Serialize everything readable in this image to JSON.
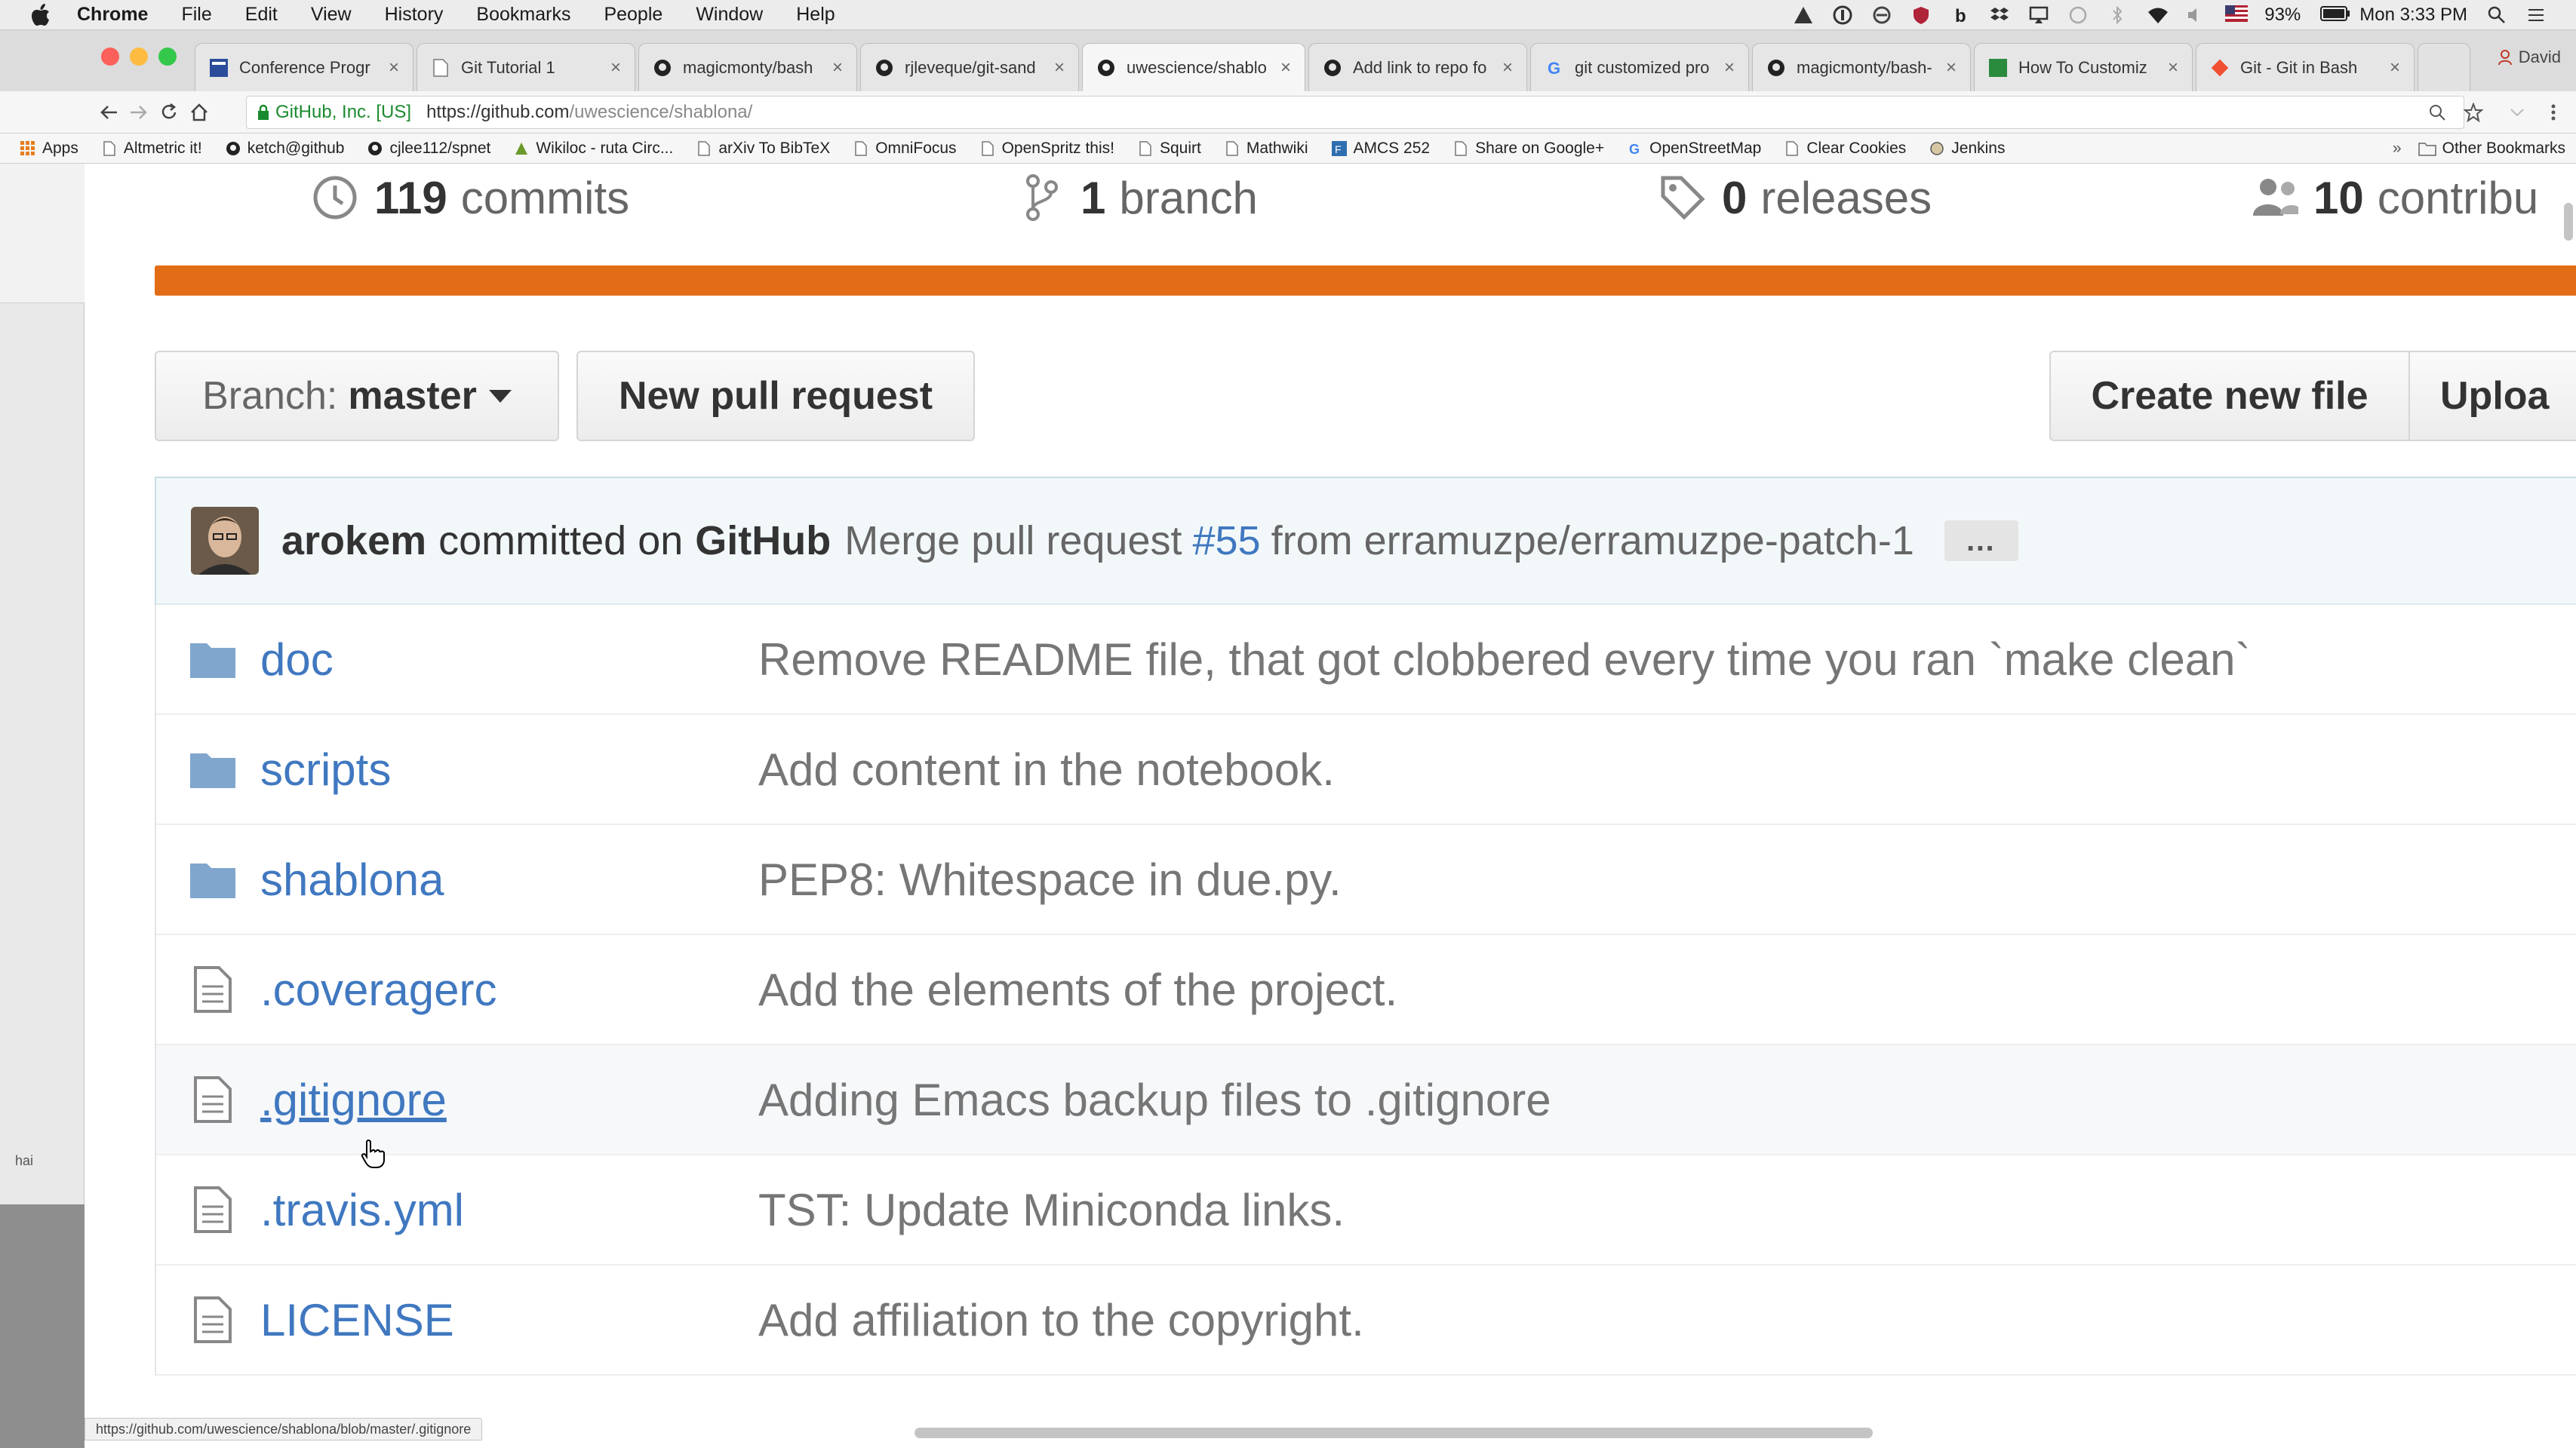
{
  "menubar": {
    "app": "Chrome",
    "items": [
      "File",
      "Edit",
      "View",
      "History",
      "Bookmarks",
      "People",
      "Window",
      "Help"
    ],
    "battery": "93%",
    "clock": "Mon 3:33 PM"
  },
  "tabs": [
    {
      "label": "Conference Progr",
      "icon": "conference-favicon"
    },
    {
      "label": "Git Tutorial 1",
      "icon": "page-icon"
    },
    {
      "label": "magicmonty/bash",
      "icon": "github-icon"
    },
    {
      "label": "rjleveque/git-sand",
      "icon": "github-icon"
    },
    {
      "label": "uwescience/shablo",
      "icon": "github-icon"
    },
    {
      "label": "Add link to repo fo",
      "icon": "github-icon"
    },
    {
      "label": "git customized pro",
      "icon": "google-icon"
    },
    {
      "label": "magicmonty/bash-",
      "icon": "github-icon"
    },
    {
      "label": "How To Customiz",
      "icon": "site-favicon"
    },
    {
      "label": "Git - Git in Bash",
      "icon": "git-icon"
    }
  ],
  "profile": "David",
  "omnibox": {
    "secure_label": "GitHub, Inc. [US]",
    "url_host": "https://github.com",
    "url_path": "/uwescience/shablona/"
  },
  "bookmarks": [
    {
      "label": "Apps",
      "icon": "apps-grid-icon"
    },
    {
      "label": "Altmetric it!",
      "icon": "page-icon"
    },
    {
      "label": "ketch@github",
      "icon": "github-icon"
    },
    {
      "label": "cjlee112/spnet",
      "icon": "github-icon"
    },
    {
      "label": "Wikiloc - ruta Circ...",
      "icon": "wikiloc-icon"
    },
    {
      "label": "arXiv To BibTeX",
      "icon": "page-icon"
    },
    {
      "label": "OmniFocus",
      "icon": "page-icon"
    },
    {
      "label": "OpenSpritz this!",
      "icon": "page-icon"
    },
    {
      "label": "Squirt",
      "icon": "page-icon"
    },
    {
      "label": "Mathwiki",
      "icon": "page-icon"
    },
    {
      "label": "AMCS 252",
      "icon": "amcs-icon"
    },
    {
      "label": "Share on Google+",
      "icon": "page-icon"
    },
    {
      "label": "OpenStreetMap",
      "icon": "google-icon"
    },
    {
      "label": "Clear Cookies",
      "icon": "page-icon"
    },
    {
      "label": "Jenkins",
      "icon": "jenkins-icon"
    }
  ],
  "bookmarks_other": "Other Bookmarks",
  "left_window_label": "hai",
  "repo": {
    "stats": {
      "commits_num": "119",
      "commits_label": "commits",
      "branches_num": "1",
      "branches_label": "branch",
      "releases_num": "0",
      "releases_label": "releases",
      "contributors_num": "10",
      "contributors_label": "contribu"
    },
    "branch_prefix": "Branch:",
    "branch_name": "master",
    "new_pr": "New pull request",
    "create_file": "Create new file",
    "upload": "Uploa",
    "commit": {
      "author": "arokem",
      "mid": "committed on",
      "via": "GitHub",
      "message_pre": "Merge pull request",
      "pr_number": "#55",
      "message_post": "from erramuzpe/erramuzpe-patch-1",
      "ellipsis": "…"
    },
    "files": [
      {
        "type": "dir",
        "name": "doc",
        "message": "Remove README file, that got clobbered every time you ran `make clean`"
      },
      {
        "type": "dir",
        "name": "scripts",
        "message": "Add content in the notebook."
      },
      {
        "type": "dir",
        "name": "shablona",
        "message": "PEP8: Whitespace in due.py."
      },
      {
        "type": "file",
        "name": ".coveragerc",
        "message": "Add the elements of the project."
      },
      {
        "type": "file",
        "name": ".gitignore",
        "message": "Adding Emacs backup files to .gitignore"
      },
      {
        "type": "file",
        "name": ".travis.yml",
        "message": "TST: Update Miniconda links."
      },
      {
        "type": "file",
        "name": "LICENSE",
        "message": "Add affiliation to the copyright."
      }
    ]
  },
  "status_url": "https://github.com/uwescience/shablona/blob/master/.gitignore",
  "colors": {
    "language_bar": "#e36d16",
    "link": "#4078c0",
    "folder": "#80a6cd"
  }
}
